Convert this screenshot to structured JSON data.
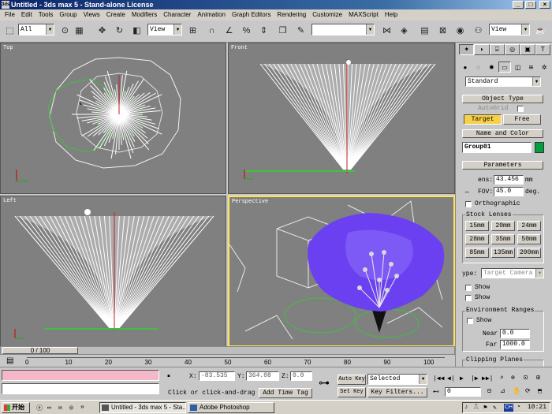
{
  "title_bar": {
    "app_icon": "3ds",
    "title": "Untitled - 3ds max 5 - Stand-alone License"
  },
  "menu": [
    "File",
    "Edit",
    "Tools",
    "Group",
    "Views",
    "Create",
    "Modifiers",
    "Character",
    "Animation",
    "Graph Editors",
    "Rendering",
    "Customize",
    "MAXScript",
    "Help"
  ],
  "toolbar": {
    "selection_filter": "All",
    "ref_coord": "View",
    "named_selection": "",
    "view_dropdown": "View"
  },
  "viewports": {
    "top": "Top",
    "front": "Front",
    "left": "Left",
    "perspective": "Perspective"
  },
  "command_panel": {
    "category": "Standard",
    "object_type": {
      "header": "Object Type",
      "autogrid": "AutoGrid",
      "target": "Target",
      "free": "Free"
    },
    "name_color": {
      "header": "Name and Color",
      "name": "Group01",
      "color": "#00a040"
    },
    "parameters": {
      "header": "Parameters",
      "lens_label": "ens:",
      "lens_value": "43.456",
      "lens_unit": "mm",
      "fov_label": "FOV:",
      "fov_value": "45.0",
      "fov_unit": "deg.",
      "orthographic": "Orthographic",
      "stock_lenses": "Stock Lenses",
      "lenses": [
        "15mm",
        "20mm",
        "24mm",
        "28mm",
        "35mm",
        "50mm",
        "85mm",
        "135mm",
        "200mm"
      ],
      "type_label": "ype:",
      "type_value": "Target Camera",
      "show_cone": "Show",
      "show_horizon": "Show",
      "env_ranges": "Environment Ranges",
      "env_show": "Show",
      "near_label": "Near",
      "near_value": "0.0",
      "far_label": "Far",
      "far_value": "1000.0",
      "clipping": "Clipping Planes"
    }
  },
  "timeline": {
    "frame_slider": "0 / 100",
    "ticks": [
      "0",
      "10",
      "20",
      "30",
      "40",
      "50",
      "60",
      "70",
      "80",
      "90",
      "100"
    ]
  },
  "status": {
    "x_label": "X:",
    "x_value": "-83.535",
    "y_label": "Y:",
    "y_value": "364.08",
    "z_label": "Z:",
    "z_value": "0.0",
    "prompt": "Click or click-and-drag",
    "add_time_tag": "Add Time Tag",
    "auto_key": "Auto Key",
    "set_key": "Set Key",
    "key_mode": "Selected",
    "key_filters": "Key Filters...",
    "current_frame": "0"
  },
  "taskbar": {
    "start": "开始",
    "tasks": [
      "Untitled - 3ds max 5 - Sta...",
      "Adobe Photoshop"
    ],
    "tray_lang": "CH",
    "clock": "10:21"
  }
}
